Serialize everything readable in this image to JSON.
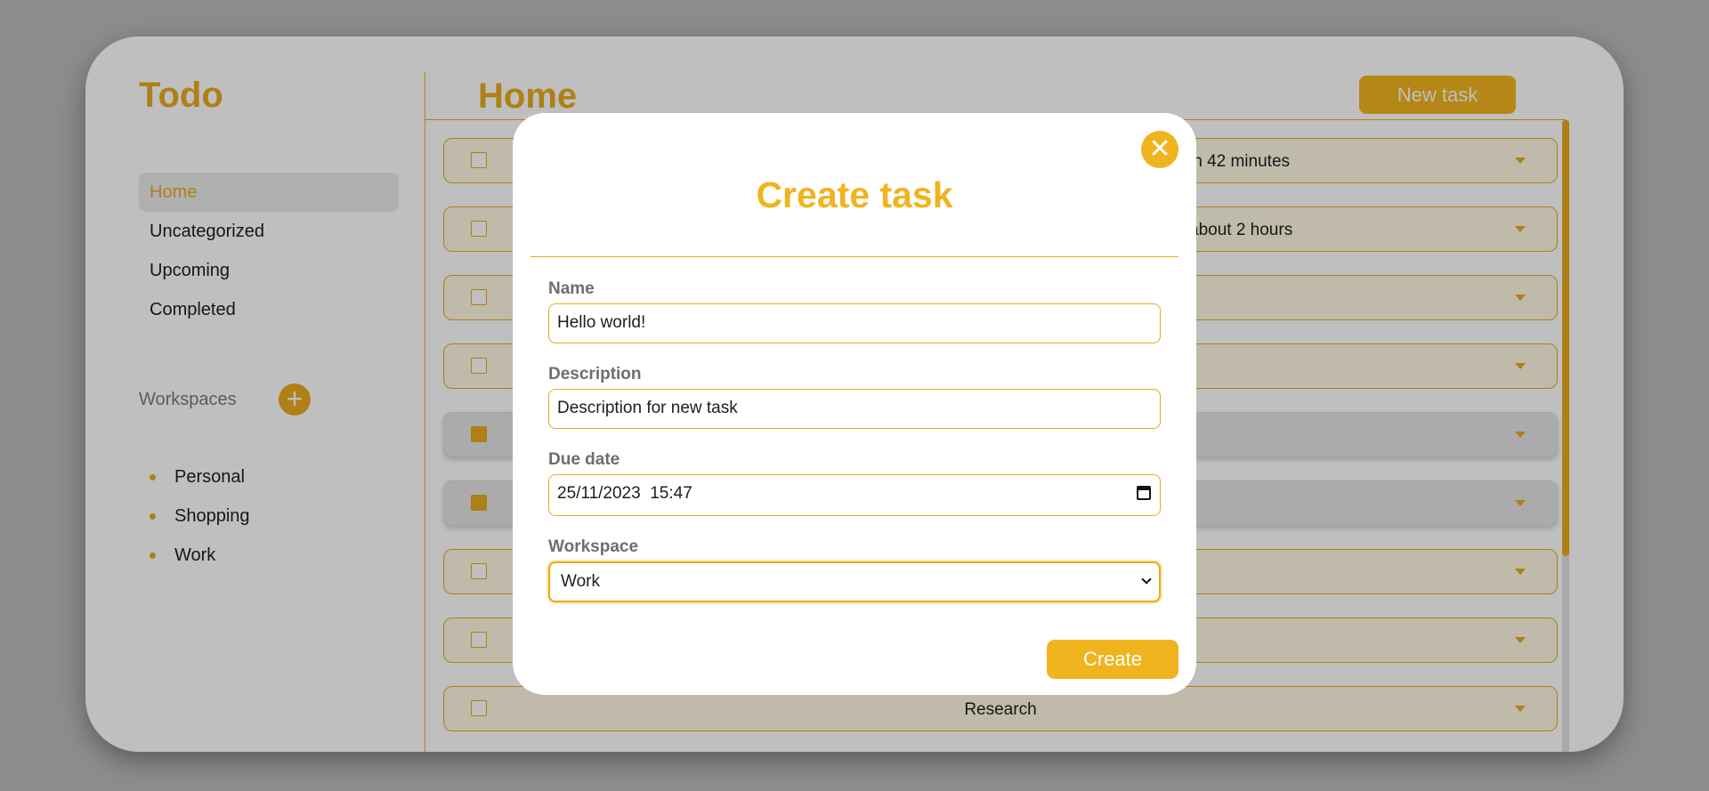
{
  "colors": {
    "accent": "#f0b41f",
    "overlay": "rgba(0,0,0,0.25)"
  },
  "sidebar": {
    "brand": "Todo",
    "nav": [
      {
        "label": "Home",
        "active": true
      },
      {
        "label": "Uncategorized"
      },
      {
        "label": "Upcoming"
      },
      {
        "label": "Completed"
      }
    ],
    "workspaces_title": "Workspaces",
    "add_workspace_icon": "plus-icon",
    "workspaces": [
      {
        "label": "Personal"
      },
      {
        "label": "Shopping"
      },
      {
        "label": "Work"
      }
    ]
  },
  "main": {
    "title": "Home",
    "new_task_label": "New task",
    "tasks": [
      {
        "name": "",
        "due": "in 42 minutes",
        "completed": false
      },
      {
        "name": "",
        "due": "about 2 hours",
        "completed": false
      },
      {
        "name": "",
        "due": "",
        "completed": false
      },
      {
        "name": "",
        "due": "",
        "completed": false
      },
      {
        "name": "",
        "due": "",
        "completed": true
      },
      {
        "name": "",
        "due": "",
        "completed": true
      },
      {
        "name": "",
        "due": "",
        "completed": false
      },
      {
        "name": "",
        "due": "",
        "completed": false
      },
      {
        "name": "Research",
        "due": "",
        "completed": false
      }
    ]
  },
  "modal": {
    "title": "Create task",
    "close_icon": "close-icon",
    "name_label": "Name",
    "name_value": "Hello world!",
    "description_label": "Description",
    "description_value": "Description for new task",
    "due_label": "Due date",
    "due_value": "25/11/2023  15:47",
    "workspace_label": "Workspace",
    "workspace_value": "Work",
    "create_label": "Create"
  }
}
